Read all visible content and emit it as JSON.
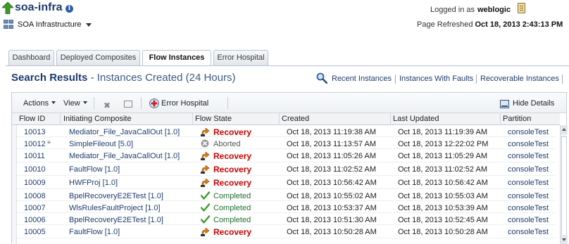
{
  "app": {
    "title": "soa-infra",
    "info_glyph": "i",
    "logged_in_label": "Logged in as",
    "user": "weblogic",
    "target_label": "SOA Infrastructure",
    "refresh_label": "Page Refreshed",
    "refresh_time": "Oct 18, 2013 2:43:13 PM"
  },
  "tabs": [
    {
      "label": "Dashboard",
      "active": false
    },
    {
      "label": "Deployed Composites",
      "active": false
    },
    {
      "label": "Flow Instances",
      "active": true
    },
    {
      "label": "Error Hospital",
      "active": false
    }
  ],
  "search": {
    "title": "Search Results",
    "subtitle": "- Instances Created (24 Hours)",
    "links": [
      "Recent Instances",
      "Instances With Faults",
      "Recoverable Instances"
    ]
  },
  "toolbar": {
    "actions_label": "Actions",
    "view_label": "View",
    "delete_glyph": "✖",
    "error_hospital_label": "Error Hospital",
    "hide_details_label": "Hide Details"
  },
  "table": {
    "columns": [
      "Flow ID",
      "Initiating Composite",
      "Flow State",
      "Created",
      "Last Updated",
      "Partition"
    ],
    "rows": [
      {
        "flow_id": "10013",
        "composite": "Mediator_File_JavaCallOut [1.0]",
        "state": "Recovery",
        "created": "Oct 18, 2013 11:19:38 AM",
        "updated": "Oct 18, 2013 11:19:39 AM",
        "partition": "consoleTest"
      },
      {
        "flow_id": "10012",
        "composite": "SimpleFileout [5.0]",
        "state": "Aborted",
        "created": "Oct 18, 2013 11:13:57 AM",
        "updated": "Oct 18, 2013 12:22:02 PM",
        "partition": "consoleTest"
      },
      {
        "flow_id": "10011",
        "composite": "Mediator_File_JavaCallOut [1.0]",
        "state": "Recovery",
        "created": "Oct 18, 2013 11:05:26 AM",
        "updated": "Oct 18, 2013 11:05:29 AM",
        "partition": "consoleTest"
      },
      {
        "flow_id": "10010",
        "composite": "FaultFlow [1.0]",
        "state": "Recovery",
        "created": "Oct 18, 2013 11:02:52 AM",
        "updated": "Oct 18, 2013 11:02:52 AM",
        "partition": "consoleTest"
      },
      {
        "flow_id": "10009",
        "composite": "HWFProj [1.0]",
        "state": "Recovery",
        "created": "Oct 18, 2013 10:56:42 AM",
        "updated": "Oct 18, 2013 10:56:42 AM",
        "partition": "consoleTest"
      },
      {
        "flow_id": "10008",
        "composite": "BpelRecoveryE2ETest [1.0]",
        "state": "Completed",
        "created": "Oct 18, 2013 10:55:02 AM",
        "updated": "Oct 18, 2013 10:55:03 AM",
        "partition": "consoleTest"
      },
      {
        "flow_id": "10007",
        "composite": "WlsRulesFaultProject [1.0]",
        "state": "Completed",
        "created": "Oct 18, 2013 10:53:37 AM",
        "updated": "Oct 18, 2013 10:53:39 AM",
        "partition": "consoleTest"
      },
      {
        "flow_id": "10006",
        "composite": "BpelRecoveryE2ETest [1.0]",
        "state": "Completed",
        "created": "Oct 18, 2013 10:51:30 AM",
        "updated": "Oct 18, 2013 10:52:45 AM",
        "partition": "consoleTest"
      },
      {
        "flow_id": "10005",
        "composite": "FaultFlow [1.0]",
        "state": "Recovery",
        "created": "Oct 18, 2013 10:50:28 AM",
        "updated": "Oct 18, 2013 10:50:28 AM",
        "partition": "consoleTest"
      }
    ]
  },
  "colors": {
    "title_blue": "#1f3b6e",
    "recovery_red": "#cc0000",
    "completed_green": "#1f6e2d"
  },
  "icons": {
    "nav": "up-arrow-icon",
    "info": "info-icon",
    "user": "user-badge-icon",
    "target": "soa-target-icon",
    "search": "magnify-icon",
    "recovery": "recovery-icon",
    "aborted": "aborted-icon",
    "completed": "check-icon"
  }
}
